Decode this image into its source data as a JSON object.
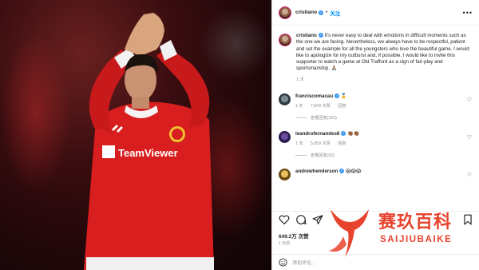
{
  "post": {
    "username": "cristiano",
    "follow_label": "关注",
    "more_label": "•••",
    "caption_text": "It's never easy to deal with emotions in difficult moments such as the one we are facing. Nevertheless, we always have to be respectful, patient and set the example for all the youngsters who love the beautiful game. I would like to apologize for my outburst and, if possible, I would like to invite this supporter to watch a game at Old Trafford as a sign of fair-play and sportsmanship.",
    "caption_emoji": "🙏🏽",
    "caption_time": "1 天"
  },
  "comments": [
    {
      "username": "franciscomacau",
      "emoji": "🏅",
      "time": "1 天",
      "likes": "7,843 次赞",
      "reply_label": "回复",
      "view_replies": "查看回复(324)"
    },
    {
      "username": "leandrofernandes8",
      "emoji": "👏🏾👏🏾",
      "time": "1 天",
      "likes": "5,859 次赞",
      "reply_label": "回复",
      "view_replies": "查看回复(62)"
    },
    {
      "username": "andrewhenderson",
      "emoji": "😱😱😱",
      "time": "",
      "likes": "",
      "reply_label": "",
      "view_replies": ""
    }
  ],
  "footer": {
    "likes": "649.2万 次赞",
    "time_ago": "1 天前",
    "add_comment_placeholder": "添加评论..."
  },
  "watermark": {
    "chinese": "赛玖百科",
    "english": "SAIJIUBAIKE"
  },
  "colors": {
    "accent_blue": "#0095f6",
    "watermark_red": "#e8432c",
    "jersey_red": "#d81e1e"
  }
}
